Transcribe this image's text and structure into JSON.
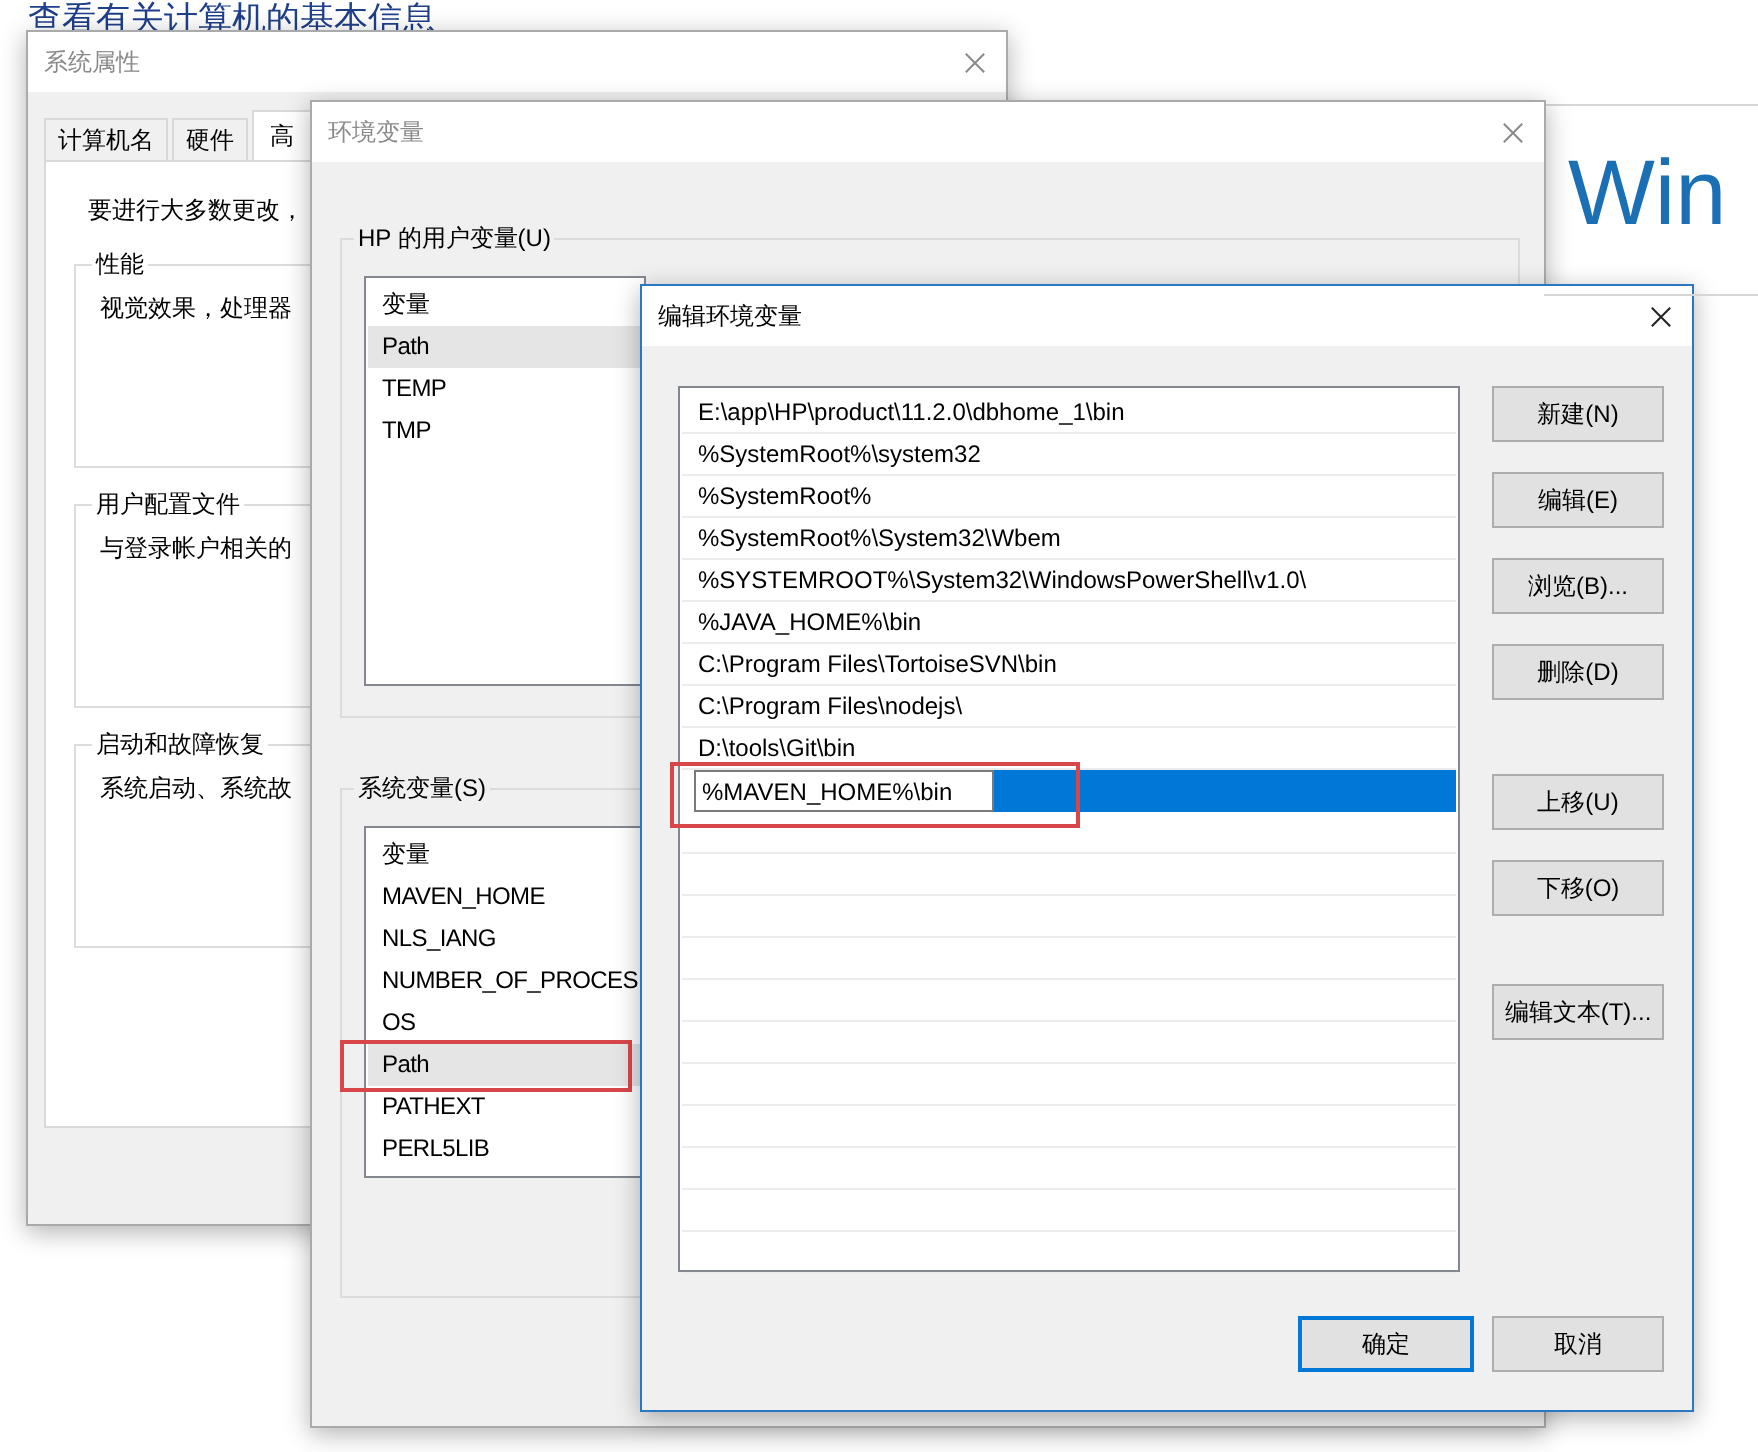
{
  "background": {
    "heading": "查看有关计算机的基本信息",
    "brand": "Win"
  },
  "system_properties": {
    "title": "系统属性",
    "tabs": [
      {
        "label": "计算机名",
        "selected": false
      },
      {
        "label": "硬件",
        "selected": false
      },
      {
        "label": "高",
        "selected": true
      }
    ],
    "intro": "要进行大多数更改，",
    "groups": [
      {
        "title": "性能",
        "text": "视觉效果，处理器"
      },
      {
        "title": "用户配置文件",
        "text": "与登录帐户相关的"
      },
      {
        "title": "启动和故障恢复",
        "text": "系统启动、系统故"
      }
    ]
  },
  "environment_variables": {
    "title": "环境变量",
    "groups": [
      {
        "title": "HP 的用户变量(U)",
        "column": "变量",
        "rows": [
          {
            "name": "Path",
            "selected": true,
            "highlighted": false
          },
          {
            "name": "TEMP",
            "selected": false,
            "highlighted": false
          },
          {
            "name": "TMP",
            "selected": false,
            "highlighted": false
          }
        ]
      },
      {
        "title": "系统变量(S)",
        "column": "变量",
        "rows": [
          {
            "name": "MAVEN_HOME",
            "selected": false,
            "highlighted": false
          },
          {
            "name": "NLS_IANG",
            "selected": false,
            "highlighted": false
          },
          {
            "name": "NUMBER_OF_PROCES",
            "selected": false,
            "highlighted": false
          },
          {
            "name": "OS",
            "selected": false,
            "highlighted": false
          },
          {
            "name": "Path",
            "selected": true,
            "highlighted": true
          },
          {
            "name": "PATHEXT",
            "selected": false,
            "highlighted": false
          },
          {
            "name": "PERL5LIB",
            "selected": false,
            "highlighted": false
          }
        ]
      }
    ]
  },
  "edit_dialog": {
    "title": "编辑环境变量",
    "entries": [
      {
        "kind": "text",
        "text": "E:\\app\\HP\\product\\11.2.0\\dbhome_1\\bin",
        "selected": false,
        "highlighted": false
      },
      {
        "kind": "text",
        "text": "%SystemRoot%\\system32",
        "selected": false,
        "highlighted": false
      },
      {
        "kind": "text",
        "text": "%SystemRoot%",
        "selected": false,
        "highlighted": false
      },
      {
        "kind": "text",
        "text": "%SystemRoot%\\System32\\Wbem",
        "selected": false,
        "highlighted": false
      },
      {
        "kind": "text",
        "text": "%SYSTEMROOT%\\System32\\WindowsPowerShell\\v1.0\\",
        "selected": false,
        "highlighted": false
      },
      {
        "kind": "text",
        "text": "%JAVA_HOME%\\bin",
        "selected": false,
        "highlighted": false
      },
      {
        "kind": "text",
        "text": "C:\\Program Files\\TortoiseSVN\\bin",
        "selected": false,
        "highlighted": false
      },
      {
        "kind": "text",
        "text": "C:\\Program Files\\nodejs\\",
        "selected": false,
        "highlighted": false
      },
      {
        "kind": "text",
        "text": "D:\\tools\\Git\\bin",
        "selected": false,
        "highlighted": false
      },
      {
        "kind": "edit",
        "text": "%MAVEN_HOME%\\bin",
        "selected": true,
        "highlighted": true
      }
    ],
    "button_groups": [
      [
        "新建(N)",
        "编辑(E)",
        "浏览(B)...",
        "删除(D)"
      ],
      [
        "上移(U)",
        "下移(O)"
      ],
      [
        "编辑文本(T)..."
      ]
    ],
    "footer_buttons": [
      {
        "label": "确定",
        "default": true
      },
      {
        "label": "取消",
        "default": false
      }
    ]
  }
}
